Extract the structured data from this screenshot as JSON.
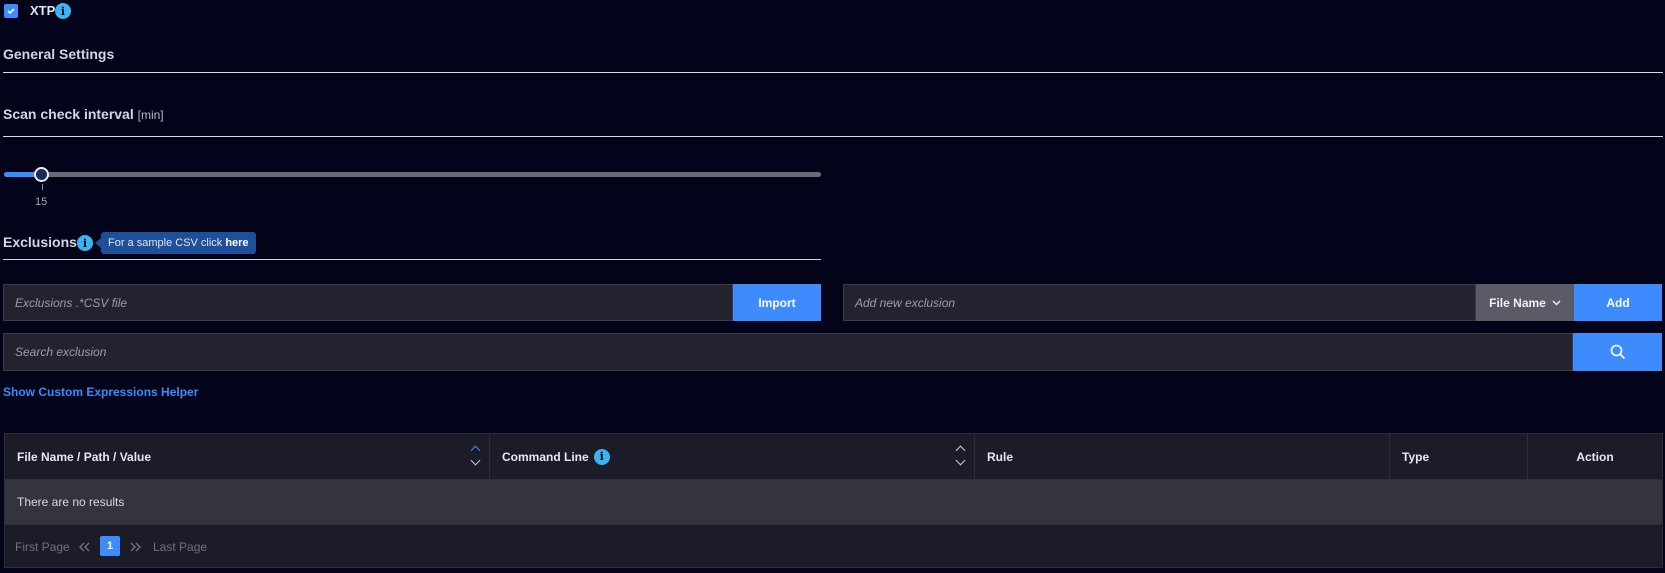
{
  "module": {
    "label": "XTP",
    "enabled": true
  },
  "general": {
    "title": "General Settings"
  },
  "scan": {
    "title": "Scan check interval",
    "units": "[min]",
    "value": "15",
    "value_fraction": 0.047
  },
  "exclusions": {
    "title": "Exclusions",
    "tooltip_text": "For a sample CSV click",
    "tooltip_link": "here",
    "file_placeholder": "Exclusions .*CSV file",
    "import_label": "Import",
    "add_placeholder": "Add new exclusion",
    "type_select": "File Name",
    "add_label": "Add",
    "search_placeholder": "Search exclusion",
    "helper_link": "Show Custom Expressions Helper"
  },
  "table": {
    "columns": [
      "File Name / Path / Value",
      "Command Line",
      "Rule",
      "Type",
      "Action"
    ],
    "empty_text": "There are no results"
  },
  "pagination": {
    "first": "First Page",
    "current": "1",
    "last": "Last Page"
  },
  "colors": {
    "accent": "#3d8bfd",
    "info": "#3ab3f0",
    "background": "#03041a"
  },
  "icons": [
    "check-icon",
    "info-icon",
    "search-icon",
    "chevron-down-icon",
    "sort-icon",
    "double-chevron-left-icon",
    "double-chevron-right-icon"
  ]
}
